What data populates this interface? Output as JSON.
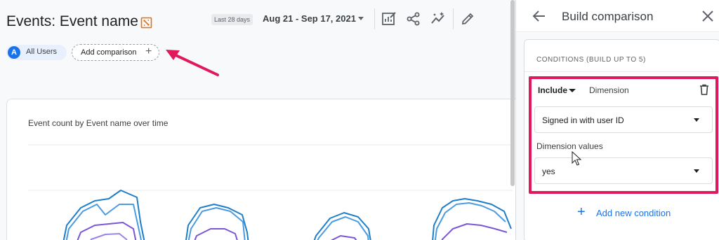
{
  "header": {
    "title": "Events: Event name",
    "date_preset": "Last 28 days",
    "date_range": "Aug 21 - Sep 17, 2021"
  },
  "comparisons": {
    "all_users_avatar": "A",
    "all_users_label": "All Users",
    "add_label": "Add comparison",
    "add_icon": "+"
  },
  "chart": {
    "title": "Event count by Event name over time"
  },
  "panel": {
    "title": "Build comparison",
    "conditions_heading": "CONDITIONS (BUILD UP TO 5)",
    "include_label": "Include",
    "dimension_label": "Dimension",
    "dimension_value": "Signed in with user ID",
    "dimension_values_label": "Dimension values",
    "selected_value": "yes",
    "add_condition_icon": "+",
    "add_condition_label": "Add new condition"
  },
  "colors": {
    "accent": "#1a73e8",
    "highlight": "#e0195a",
    "series_blue": "#1e7ec8",
    "series_purple": "#7b57d6"
  },
  "icons": [
    "export-icon",
    "customize-icon",
    "share-icon",
    "insights-icon",
    "edit-icon",
    "back-arrow-icon",
    "close-icon",
    "trash-icon",
    "dropdown-caret-icon",
    "plus-icon",
    "cursor-icon"
  ]
}
